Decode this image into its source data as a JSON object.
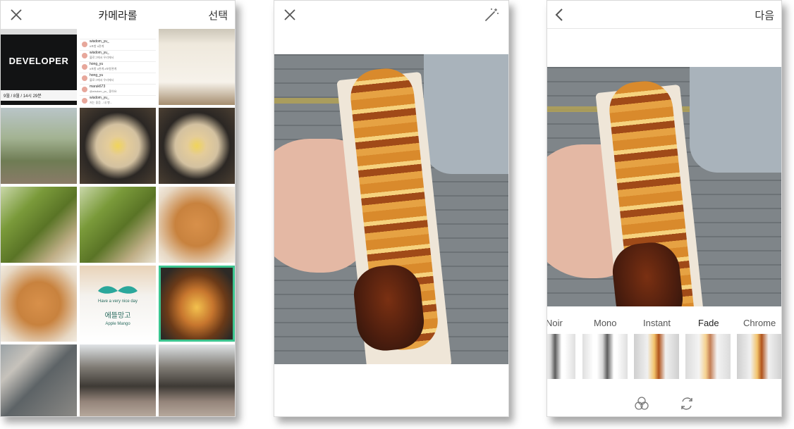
{
  "screen1": {
    "header": {
      "title": "카메라롤",
      "select_label": "선택"
    },
    "tiles": {
      "developer_title": "DEVELOPER",
      "developer_caption": "9월 / 8월 / 14시 29분",
      "comments": [
        {
          "user": "wisdom_yu_",
          "text": "#포항 #관계"
        },
        {
          "user": "wisdom_yu_",
          "text": "블로그에서 우리에서"
        },
        {
          "user": "hong_yu",
          "text": "#포항 #관계 #포항관계"
        },
        {
          "user": "hong_yu",
          "text": "블로그에서 우리에서"
        },
        {
          "user": "maruk673",
          "text": "@wisdom_yu_ 좋아요"
        },
        {
          "user": "wisdom_yu_",
          "text": "저는 좋음 ...내 빵..."
        }
      ],
      "bag_text_top": "Have a very nice day",
      "bag_text_mid": "에뜰망고",
      "bag_text_bot": "Apple Mango"
    }
  },
  "screen3": {
    "header": {
      "next_label": "다음"
    },
    "filters": [
      "Noir",
      "Mono",
      "Instant",
      "Fade",
      "Chrome"
    ],
    "selected_filter": "Fade"
  },
  "colors": {
    "selection": "#3cc48f"
  },
  "icons": {
    "close": "close-icon",
    "wand": "magic-wand-icon",
    "back": "chevron-left-icon",
    "overlap": "overlap-circles-icon",
    "rotate": "rotate-icon"
  }
}
